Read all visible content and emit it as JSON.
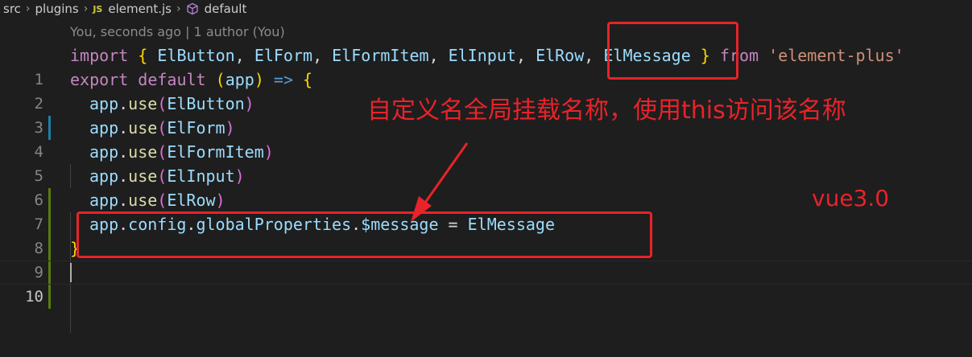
{
  "breadcrumb": {
    "segments": [
      "src",
      "plugins",
      "element.js",
      "default"
    ],
    "file_badge": "JS"
  },
  "blame": "You, seconds ago | 1 author (You)",
  "code": {
    "line_numbers": [
      "1",
      "2",
      "3",
      "4",
      "5",
      "6",
      "7",
      "8",
      "9",
      "10"
    ],
    "l1": {
      "import": "import",
      "lbrace": "{",
      "names": [
        "ElButton",
        "ElForm",
        "ElFormItem",
        "ElInput",
        "ElRow",
        "ElMessage"
      ],
      "rbrace": "}",
      "from": "from",
      "module": "'element-plus'"
    },
    "l2": {
      "export": "export",
      "default": "default",
      "param": "app",
      "arrow": "=>",
      "lbrace": "{"
    },
    "uses": [
      {
        "obj": "app",
        "method": "use",
        "arg": "ElButton"
      },
      {
        "obj": "app",
        "method": "use",
        "arg": "ElForm"
      },
      {
        "obj": "app",
        "method": "use",
        "arg": "ElFormItem"
      },
      {
        "obj": "app",
        "method": "use",
        "arg": "ElInput"
      },
      {
        "obj": "app",
        "method": "use",
        "arg": "ElRow"
      }
    ],
    "l8": {
      "obj": "app",
      "p1": "config",
      "p2": "globalProperties",
      "p3": "$message",
      "eq": "=",
      "rhs": "ElMessage"
    },
    "l9": "}"
  },
  "annotations": {
    "note": "自定义名全局挂载名称，使用this访问该名称",
    "version": "vue3.0",
    "color": "#e8232a"
  }
}
